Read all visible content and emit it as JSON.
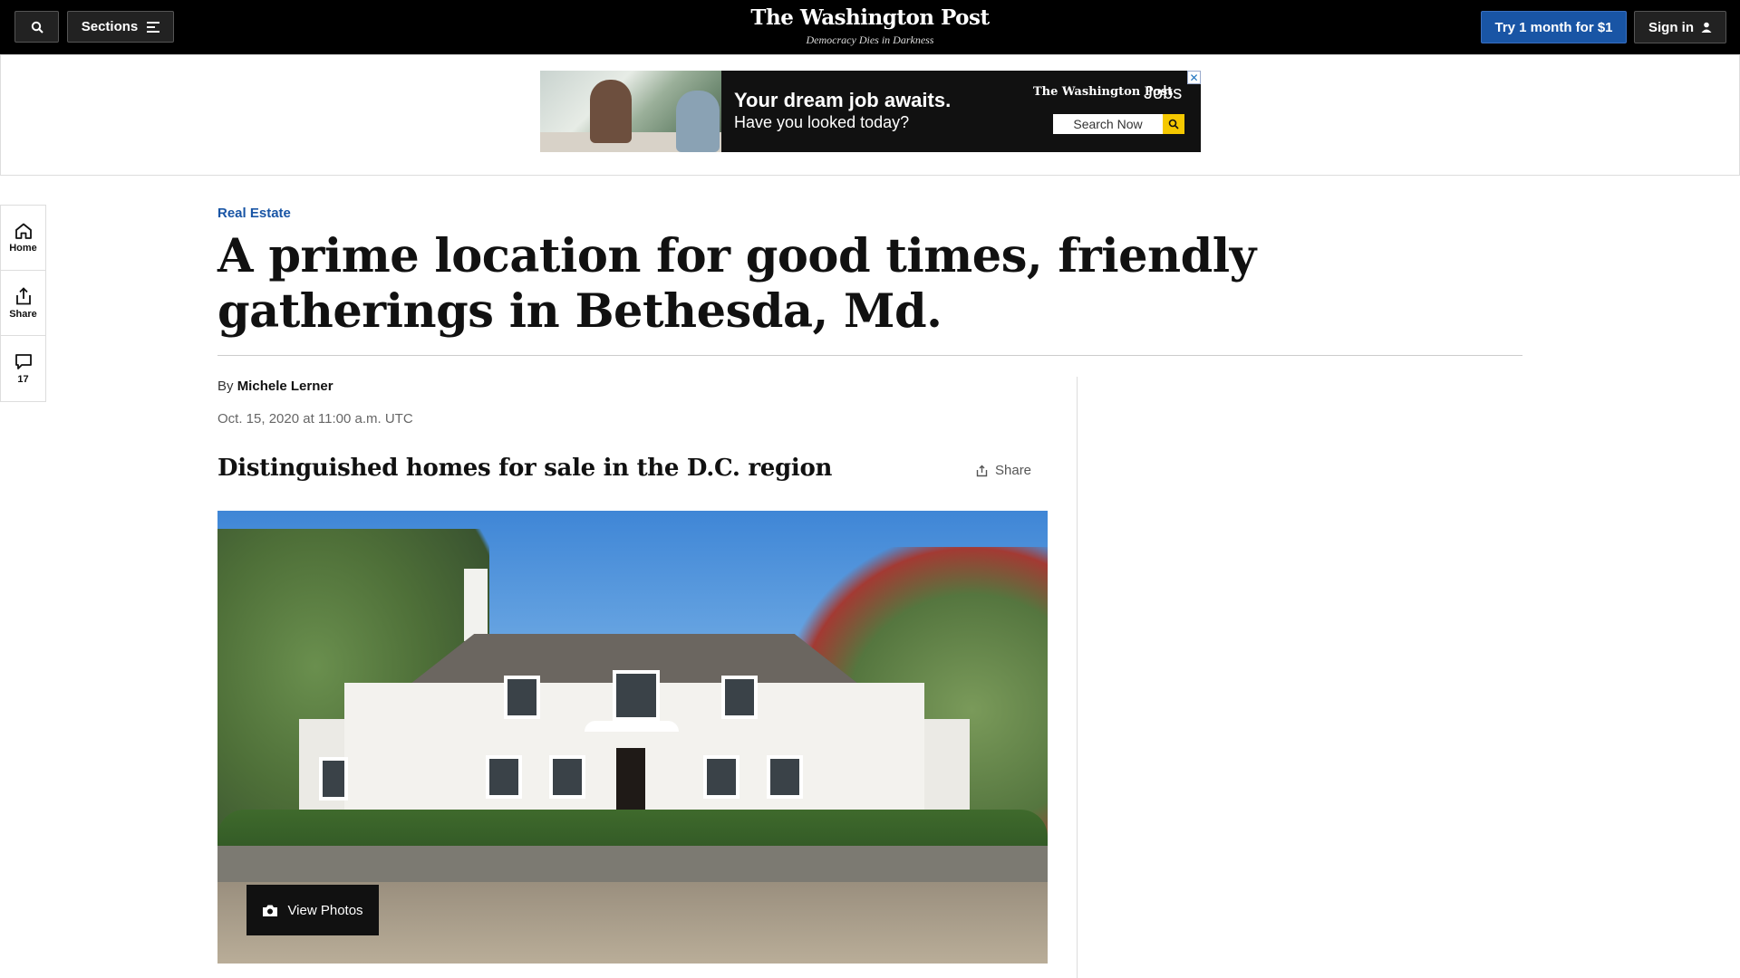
{
  "topbar": {
    "sections_label": "Sections",
    "masthead_logo": "The Washington Post",
    "masthead_tagline": "Democracy Dies in Darkness",
    "subscribe_label": "Try 1 month for $1",
    "signin_label": "Sign in"
  },
  "ad": {
    "headline": "Your dream job awaits.",
    "subline": "Have you looked today?",
    "brand": "The Washington Post",
    "brand_suffix": "Jobs",
    "search_label": "Search Now",
    "close_glyph": "✕"
  },
  "rail": {
    "home_label": "Home",
    "share_label": "Share",
    "comments_count": "17"
  },
  "article": {
    "kicker": "Real Estate",
    "headline": "A prime location for good times, friendly gatherings in Bethesda, Md.",
    "byline_prefix": "By",
    "author": "Michele Lerner",
    "date": "Oct. 15, 2020 at 11:00 a.m. UTC",
    "gallery_title": "Distinguished homes for sale in the D.C. region",
    "share_label": "Share",
    "view_photos_label": "View Photos"
  },
  "colors": {
    "accent_blue": "#1955a5",
    "topbar_bg": "#000000",
    "ad_search_button": "#f5c800"
  }
}
